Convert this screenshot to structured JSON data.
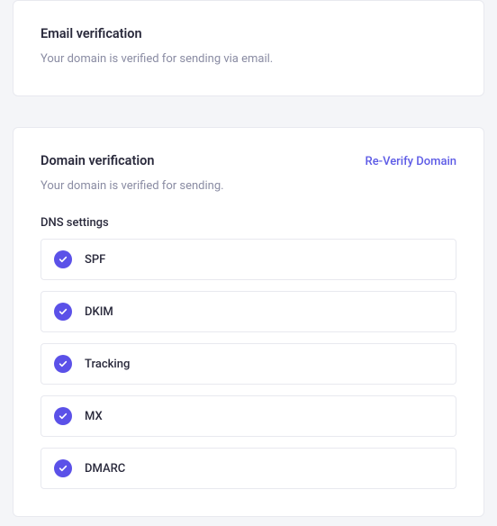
{
  "email_card": {
    "title": "Email verification",
    "subtitle": "Your domain is verified for sending via email."
  },
  "domain_card": {
    "title": "Domain verification",
    "subtitle": "Your domain is verified for sending.",
    "reverify_label": "Re-Verify Domain",
    "dns_settings_label": "DNS settings",
    "records": [
      {
        "name": "SPF"
      },
      {
        "name": "DKIM"
      },
      {
        "name": "Tracking"
      },
      {
        "name": "MX"
      },
      {
        "name": "DMARC"
      }
    ]
  }
}
